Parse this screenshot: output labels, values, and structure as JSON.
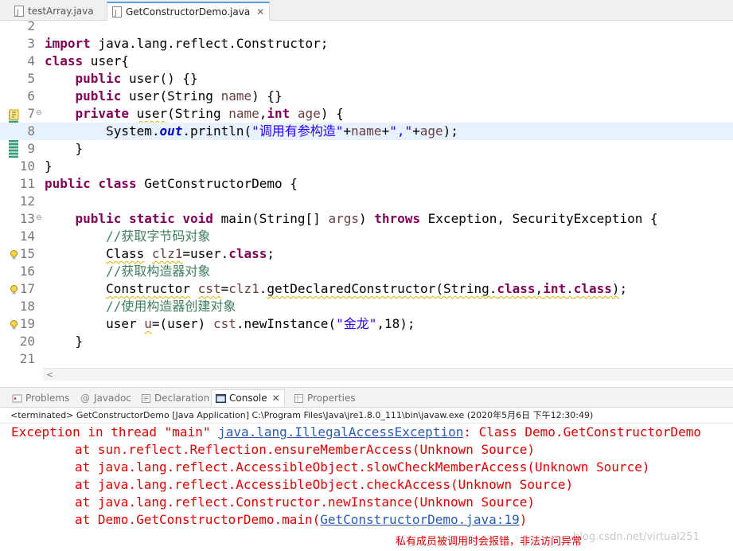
{
  "editor_tabs": [
    {
      "label": "testArray.java",
      "active": false
    },
    {
      "label": "GetConstructorDemo.java",
      "active": true
    }
  ],
  "editor": {
    "line_numbers": [
      "2",
      "3",
      "4",
      "5",
      "6",
      "7",
      "8",
      "9",
      "10",
      "11",
      "12",
      "13",
      "14",
      "15",
      "16",
      "17",
      "18",
      "19",
      "20",
      "21"
    ],
    "highlighted_line": "8"
  },
  "view_tabs": [
    {
      "label": "Problems",
      "active": false
    },
    {
      "label": "Javadoc",
      "active": false
    },
    {
      "label": "Declaration",
      "active": false
    },
    {
      "label": "Console",
      "active": true
    },
    {
      "label": "Properties",
      "active": false
    }
  ],
  "console": {
    "header": "<terminated> GetConstructorDemo [Java Application] C:\\Program Files\\Java\\jre1.8.0_111\\bin\\javaw.exe (2020年5月6日 下午12:30:49)",
    "exception_prefix": "Exception in thread \"main\" ",
    "exception_class": "java.lang.IllegalAccessException",
    "exception_message": ": Class Demo.GetConstructorDemo",
    "stack": [
      "at sun.reflect.Reflection.ensureMemberAccess(Unknown Source)",
      "at java.lang.reflect.AccessibleObject.slowCheckMemberAccess(Unknown Source)",
      "at java.lang.reflect.AccessibleObject.checkAccess(Unknown Source)",
      "at java.lang.reflect.Constructor.newInstance(Unknown Source)"
    ],
    "last_frame_prefix": "at Demo.GetConstructorDemo.main(",
    "last_frame_link": "GetConstructorDemo.java:19",
    "last_frame_suffix": ")"
  },
  "annotation_note": "私有成员被调用时会报错，非法访问异常",
  "watermark": "blog.csdn.net/virtual251",
  "colors": {
    "keyword": "#7f0055",
    "string": "#2a00ff",
    "comment": "#3f7f5f",
    "error": "#e00000",
    "link": "#2a5db0",
    "current_line": "#e8f2fe"
  }
}
